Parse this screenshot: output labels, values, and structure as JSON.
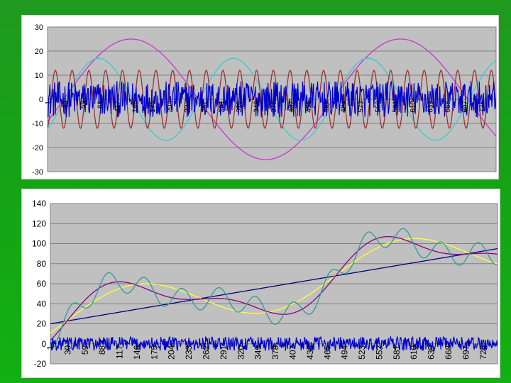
{
  "colors": {
    "plot_bg": "#c0c0c0",
    "grid": "#808080",
    "noise": "#0000cc",
    "magenta": "#cc33cc",
    "cyan": "#33cccc",
    "brown": "#993333",
    "yellow": "#ffff33",
    "teal": "#339999",
    "purple": "#880088",
    "navy": "#000080"
  },
  "chart_data": [
    {
      "type": "line",
      "title": "",
      "xlabel": "",
      "ylabel": "",
      "ylim": [
        -30,
        30
      ],
      "yticks": [
        "30",
        "20",
        "10",
        "0",
        "-10",
        "-20",
        "-30"
      ],
      "yticks_values": [
        30,
        20,
        10,
        0,
        -10,
        -20,
        -30
      ],
      "xlim": [
        1,
        750
      ],
      "x_tick_labels": [
        "1",
        "30",
        "59",
        "88",
        "117",
        "146",
        "175",
        "204",
        "233",
        "262",
        "291",
        "320",
        "349",
        "378",
        "407",
        "436",
        "465",
        "494",
        "523",
        "552",
        "581",
        "610",
        "639",
        "668",
        "697",
        "726"
      ],
      "grid": "horizontal",
      "series": [
        {
          "color_key": "magenta",
          "formula": "sine",
          "amplitude": 25,
          "period": 450,
          "phase_at": 140,
          "offset": 0,
          "description_values": {
            "peak_at_x": 140,
            "trough_at_x": 365,
            "amplitude": 25
          }
        },
        {
          "color_key": "cyan",
          "formula": "sine",
          "amplitude": 17,
          "period": 225,
          "phase_at": 85,
          "offset": 0,
          "description_values": {
            "amplitude": 17
          }
        },
        {
          "color_key": "brown",
          "formula": "sine",
          "amplitude": 12,
          "period": 28,
          "phase_at": 0,
          "offset": 0,
          "description_values": {
            "amplitude": 12
          }
        },
        {
          "color_key": "noise",
          "formula": "noise",
          "amplitude": 6,
          "offset": 0
        }
      ]
    },
    {
      "type": "line",
      "title": "",
      "xlabel": "",
      "ylabel": "",
      "ylim": [
        -20,
        140
      ],
      "yticks": [
        "140",
        "120",
        "100",
        "80",
        "60",
        "40",
        "20",
        "0",
        "-20"
      ],
      "yticks_values": [
        140,
        120,
        100,
        80,
        60,
        40,
        20,
        0,
        -20
      ],
      "xlim": [
        1,
        750
      ],
      "x_tick_labels": [
        "1",
        "30",
        "59",
        "88",
        "117",
        "146",
        "175",
        "204",
        "233",
        "262",
        "291",
        "320",
        "349",
        "378",
        "407",
        "436",
        "465",
        "494",
        "523",
        "552",
        "581",
        "610",
        "639",
        "668",
        "697",
        "726"
      ],
      "grid": "horizontal",
      "series": [
        {
          "color_key": "navy",
          "formula": "linear",
          "start": 20,
          "end": 95
        },
        {
          "color_key": "yellow",
          "formula": "trend+sine",
          "amplitude": 25,
          "period": 450,
          "phase_at": 140
        },
        {
          "color_key": "purple",
          "formula": "trend+sine+sine",
          "amplitudes": [
            25,
            17
          ],
          "periods": [
            450,
            225
          ]
        },
        {
          "color_key": "teal",
          "formula": "trend+sine+sine+sine",
          "amplitudes": [
            25,
            17,
            12
          ],
          "periods": [
            450,
            225,
            62
          ]
        },
        {
          "color_key": "noise",
          "formula": "noise",
          "amplitude": 6,
          "offset": 0
        }
      ]
    }
  ]
}
